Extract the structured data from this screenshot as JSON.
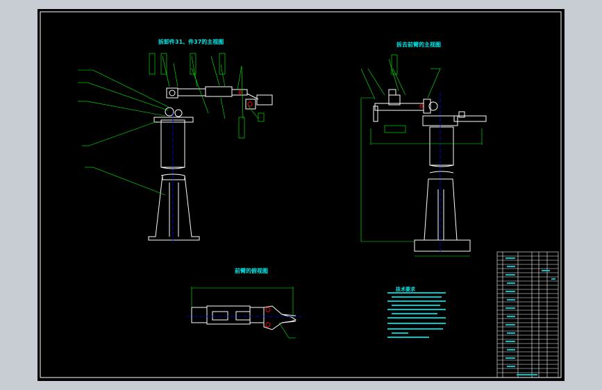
{
  "drawing": {
    "views": [
      {
        "id": "view-left",
        "title": "拆卸件31、件37的主视图"
      },
      {
        "id": "view-right",
        "title": "拆去前臂的主视图"
      },
      {
        "id": "view-bottom",
        "title": "前臂的俯视图"
      }
    ],
    "tech_requirements_title": "技术要求",
    "colors": {
      "background": "#000000",
      "outline": "#ffffff",
      "leader": "#00ff00",
      "centerline": "#0000ff",
      "text": "#00e8e8",
      "part": "#ff0000",
      "frame_border": "#ffffff",
      "desktop": "#c8ccd3"
    }
  }
}
